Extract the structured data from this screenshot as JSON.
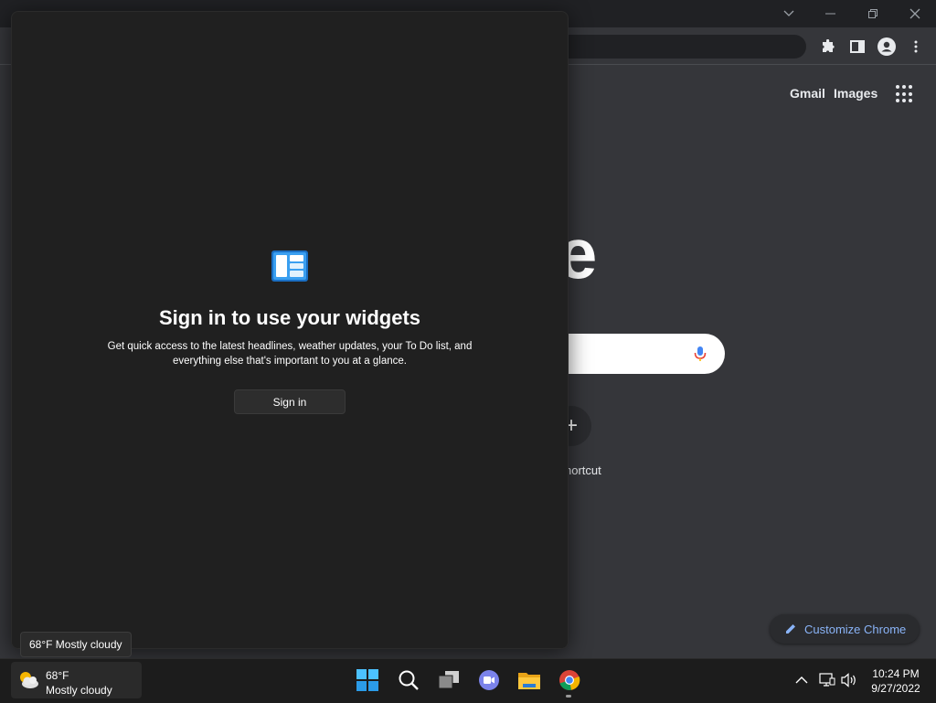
{
  "browser": {
    "window_controls": [
      "minimize",
      "restore",
      "close"
    ],
    "ntp": {
      "gmail_link": "Gmail",
      "images_link": "Images",
      "logo_partial": "e",
      "shortcut_label_partial": "hortcut",
      "customize_label": "Customize Chrome"
    }
  },
  "widgets": {
    "title": "Sign in to use your widgets",
    "description": "Get quick access to the latest headlines, weather updates, your To Do list, and everything else that's important to you at a glance.",
    "signin_label": "Sign in"
  },
  "tooltip": {
    "text": "68°F Mostly cloudy"
  },
  "taskbar": {
    "weather": {
      "temp": "68°F",
      "condition": "Mostly cloudy"
    },
    "apps": [
      "start-icon",
      "search-icon",
      "task-view-icon",
      "teams-chat-icon",
      "file-explorer-icon",
      "chrome-icon"
    ],
    "clock": {
      "time": "10:24 PM",
      "date": "9/27/2022"
    }
  },
  "colors": {
    "accent_blue": "#8ab4f8",
    "windows_blue": "#1e8ee0"
  }
}
